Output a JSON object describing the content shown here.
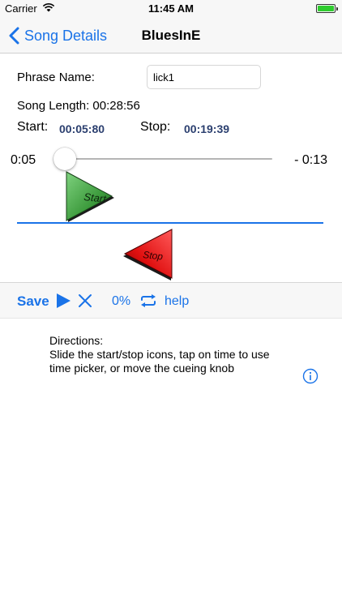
{
  "status_bar": {
    "carrier": "Carrier",
    "time": "11:45 AM",
    "wifi_icon": "wifi-icon",
    "battery_icon": "battery-icon",
    "battery_color": "#2fcc2f"
  },
  "nav": {
    "back_label": "Song Details",
    "title": "BluesInE",
    "back_icon": "chevron-left-icon"
  },
  "form": {
    "phrase_name_label": "Phrase Name:",
    "phrase_name_value": "lick1",
    "song_length_label": "Song Length: 00:28:56",
    "start_label": "Start:",
    "start_value": "00:05:80",
    "stop_label": "Stop:",
    "stop_value": "00:19:39"
  },
  "slider": {
    "elapsed": "0:05",
    "remaining": "- 0:13",
    "position_fraction": 0.03
  },
  "markers": {
    "start_label": "Start",
    "stop_label": "Stop",
    "start_color": "#3d9b3d",
    "stop_color": "#e01010"
  },
  "toolbar": {
    "save_label": "Save",
    "percent": "0%",
    "help_label": "help",
    "accent_color": "#1a73e8",
    "icons": [
      "play-icon",
      "close-icon",
      "loop-icon"
    ]
  },
  "directions": {
    "heading": "Directions:",
    "text": "Slide the start/stop icons, tap on time to use time picker, or move the cueing knob",
    "info_icon": "info-icon"
  }
}
